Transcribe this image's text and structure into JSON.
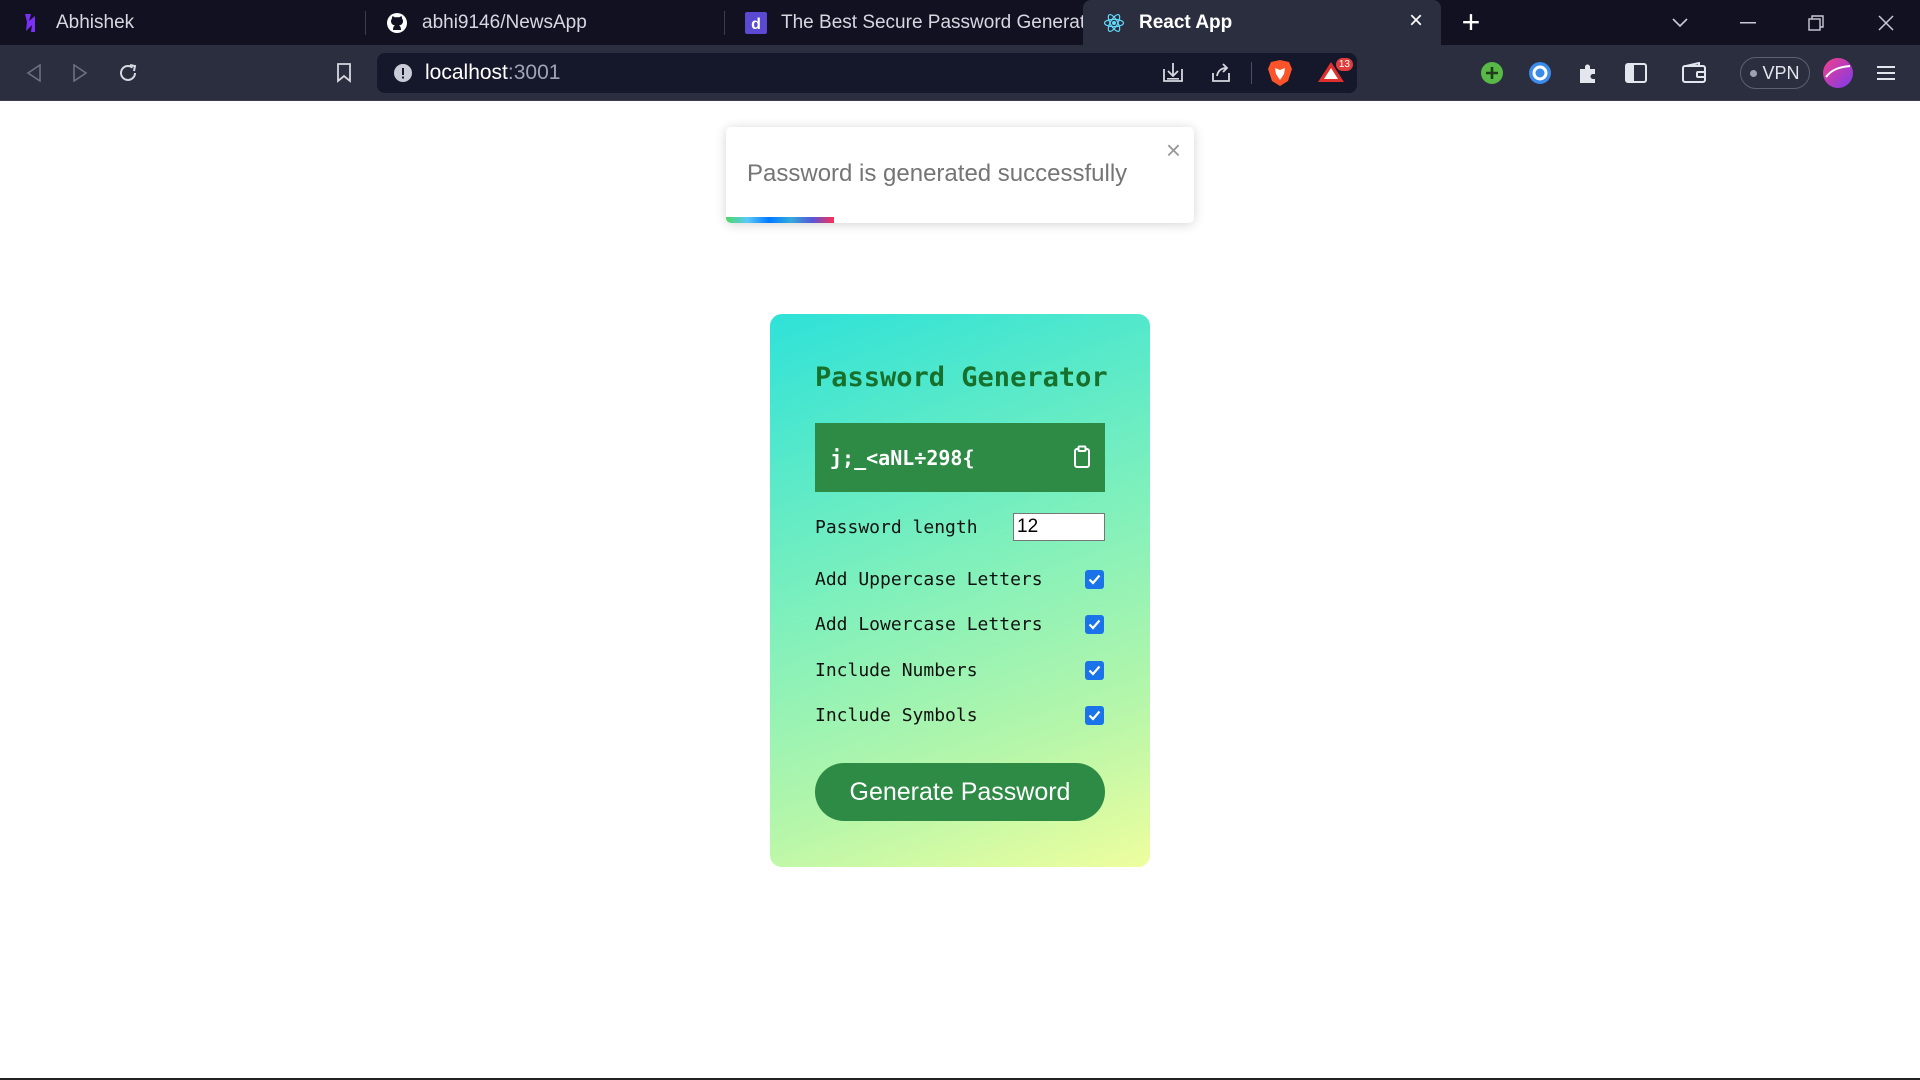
{
  "browser": {
    "tabs": [
      {
        "title": "Abhishek",
        "icon": "dark-logo-icon",
        "active": false
      },
      {
        "title": "abhi9146/NewsApp",
        "icon": "github-icon",
        "active": false
      },
      {
        "title": "The Best Secure Password Generators",
        "icon": "d-letter-icon",
        "active": false
      },
      {
        "title": "React App",
        "icon": "react-icon",
        "active": true
      }
    ],
    "url_host": "localhost",
    "url_port": ":3001",
    "shields_badge": "13",
    "vpn_label": "VPN"
  },
  "toast": {
    "message": "Password is generated successfully",
    "close": "×",
    "progress_fraction": 0.23
  },
  "generator": {
    "title": "Password Generator",
    "password": "j;_<aNL÷298{",
    "length_label": "Password length",
    "length_value": "12",
    "options": [
      {
        "label": "Add Uppercase Letters",
        "checked": true
      },
      {
        "label": "Add Lowercase Letters",
        "checked": true
      },
      {
        "label": "Include Numbers",
        "checked": true
      },
      {
        "label": "Include Symbols",
        "checked": true
      }
    ],
    "button_label": "Generate Password"
  },
  "colors": {
    "accent_green": "#2e8b46",
    "title_green": "#17702c",
    "checkbox_blue": "#1a73e8"
  }
}
